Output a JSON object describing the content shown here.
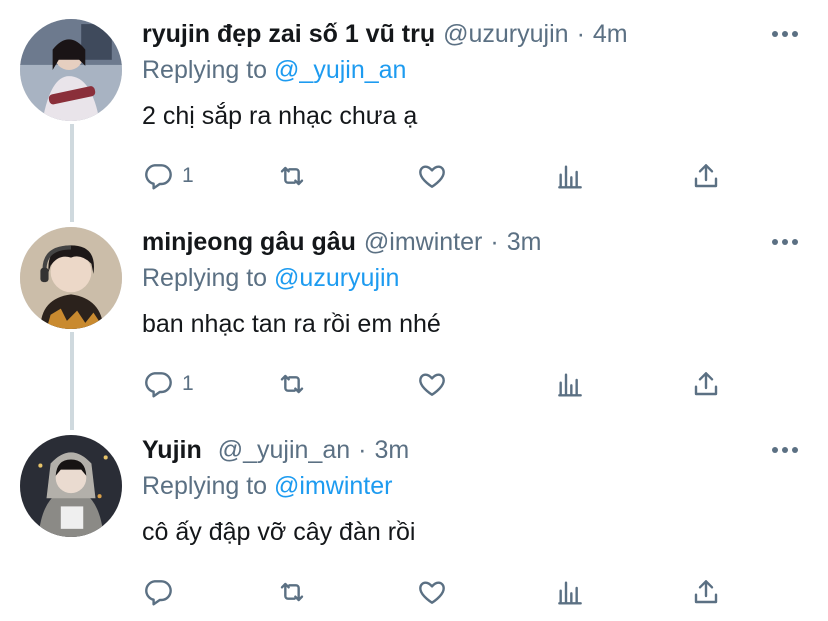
{
  "tweets": [
    {
      "name": "ryujin đẹp zai số 1 vũ trụ",
      "handle": "@uzuryujin",
      "separator": "·",
      "time": "4m",
      "replying_prefix": "Replying to",
      "replying_to": "@_yujin_an",
      "text": "2 chị sắp ra nhạc chưa ạ",
      "reply_count": "1"
    },
    {
      "name": "minjeong gâu gâu",
      "handle": "@imwinter",
      "separator": "·",
      "time": "3m",
      "replying_prefix": "Replying to",
      "replying_to": "@uzuryujin",
      "text": "ban nhạc tan ra rồi em nhé",
      "reply_count": "1"
    },
    {
      "name": "Yujin",
      "handle": "@_yujin_an",
      "separator": "·",
      "time": "3m",
      "replying_prefix": "Replying to",
      "replying_to": "@imwinter",
      "text": "cô ấy đập vỡ cây đàn rồi",
      "reply_count": ""
    }
  ],
  "icons": {
    "reply": "reply-icon",
    "retweet": "retweet-icon",
    "like": "heart-icon",
    "analytics": "analytics-icon",
    "share": "share-icon",
    "more": "more-icon"
  },
  "colors": {
    "text_primary": "#14171a",
    "text_secondary": "#5b7083",
    "link": "#1d9bf0",
    "thread_line": "#cfd9de",
    "background": "#ffffff"
  }
}
